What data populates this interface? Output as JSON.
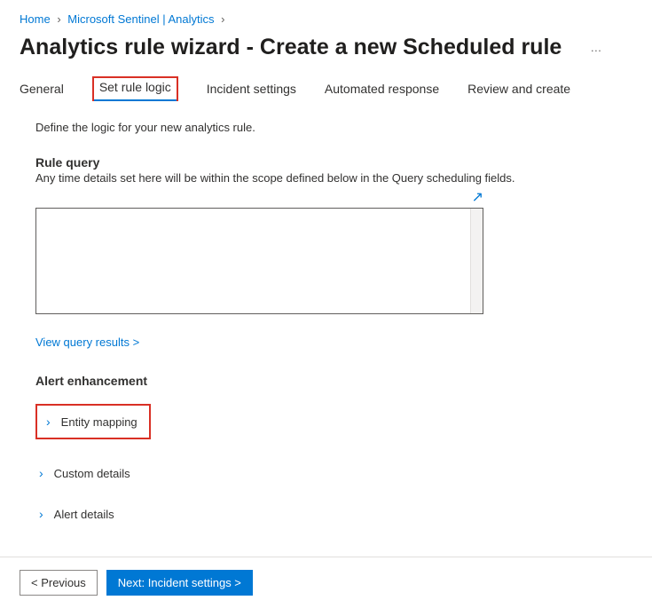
{
  "breadcrumb": {
    "home": "Home",
    "sentinel": "Microsoft Sentinel | Analytics"
  },
  "page": {
    "title": "Analytics rule wizard - Create a new Scheduled rule",
    "more": "…"
  },
  "tabs": {
    "general": "General",
    "set_rule_logic": "Set rule logic",
    "incident_settings": "Incident settings",
    "automated_response": "Automated response",
    "review_create": "Review and create"
  },
  "content": {
    "intro": "Define the logic for your new analytics rule.",
    "rule_query_title": "Rule query",
    "rule_query_sub": "Any time details set here will be within the scope defined below in the Query scheduling fields.",
    "query_value": "",
    "view_results": "View query results >",
    "alert_enhancement": "Alert enhancement",
    "expanders": {
      "entity_mapping": "Entity mapping",
      "custom_details": "Custom details",
      "alert_details": "Alert details"
    }
  },
  "buttons": {
    "previous": "< Previous",
    "next": "Next: Incident settings >"
  }
}
